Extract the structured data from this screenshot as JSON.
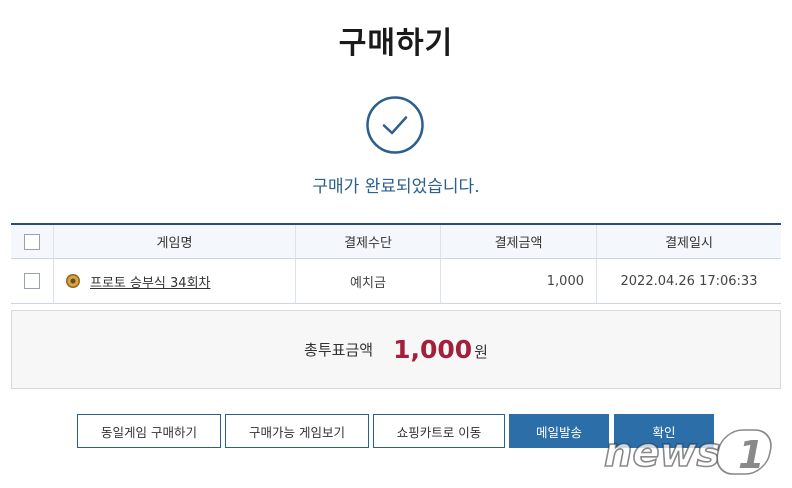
{
  "page": {
    "title": "구매하기",
    "complete_message": "구매가 완료되었습니다."
  },
  "table": {
    "headers": {
      "game": "게임명",
      "method": "결제수단",
      "amount": "결제금액",
      "date": "결제일시"
    },
    "rows": [
      {
        "game": "프로토 승부식 34회차",
        "method": "예치금",
        "amount": "1,000",
        "date": "2022.04.26 17:06:33"
      }
    ]
  },
  "total": {
    "label": "총투표금액",
    "value": "1,000",
    "unit": "원"
  },
  "buttons": {
    "same_game": "동일게임 구매하기",
    "available_games": "구매가능 게임보기",
    "cart": "쇼핑카트로 이동",
    "email": "메일발송",
    "confirm": "확인"
  },
  "watermark": {
    "text": "news1"
  },
  "colors": {
    "accent": "#2a5f8f",
    "button_solid": "#2b6ea8",
    "total_value": "#a31f3b",
    "header_border": "#2c4d75"
  }
}
